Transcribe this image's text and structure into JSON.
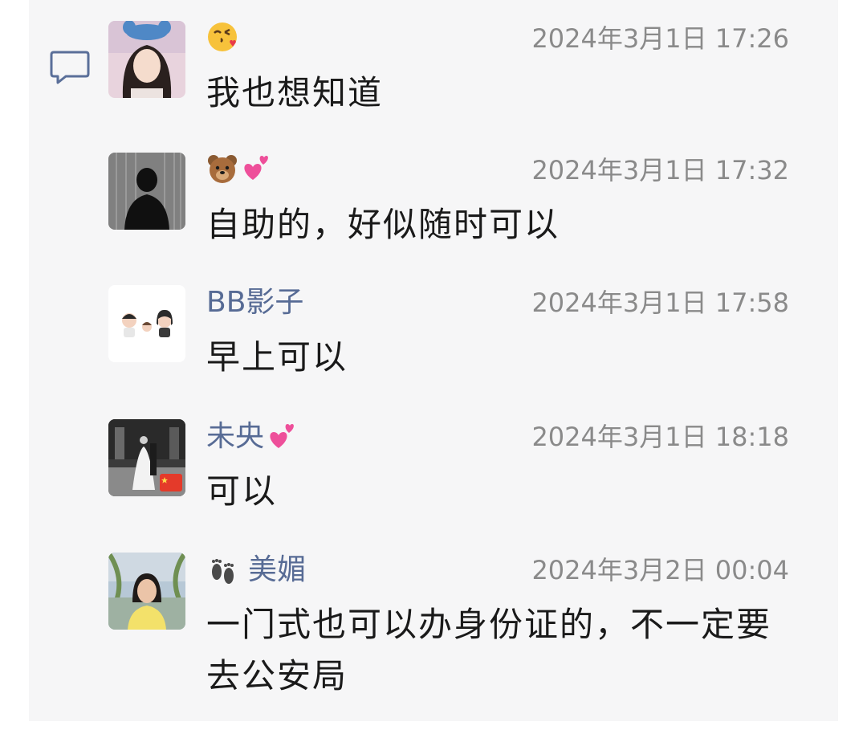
{
  "comments": [
    {
      "name": "",
      "name_emojis": [
        "kissing-face-emoji"
      ],
      "time": "2024年3月1日 17:26",
      "text": "我也想知道",
      "avatar": "girl-with-cartoon-headband-avatar"
    },
    {
      "name": "",
      "name_emojis": [
        "bear-face-emoji",
        "two-hearts-emoji"
      ],
      "time": "2024年3月1日 17:32",
      "text": "自助的，好似随时可以",
      "avatar": "man-silhouette-in-rain-avatar"
    },
    {
      "name": "BB影子",
      "name_emojis": [],
      "time": "2024年3月1日 17:58",
      "text": "早上可以",
      "avatar": "cartoon-family-avatar"
    },
    {
      "name": "未央",
      "name_emojis": [
        "two-hearts-emoji"
      ],
      "time": "2024年3月1日 18:18",
      "text": "可以",
      "avatar": "wedding-photo-with-flag-avatar"
    },
    {
      "name": "美媚",
      "name_emojis": [
        "footprints-emoji"
      ],
      "time": "2024年3月2日 00:04",
      "text": "一门式也可以办身份证的，不一定要去公安局",
      "avatar": "woman-outdoors-avatar"
    }
  ],
  "colors": {
    "name": "#576b95",
    "time": "#8a8a8a",
    "text": "#1a1a1a",
    "panel": "#f6f6f7"
  }
}
